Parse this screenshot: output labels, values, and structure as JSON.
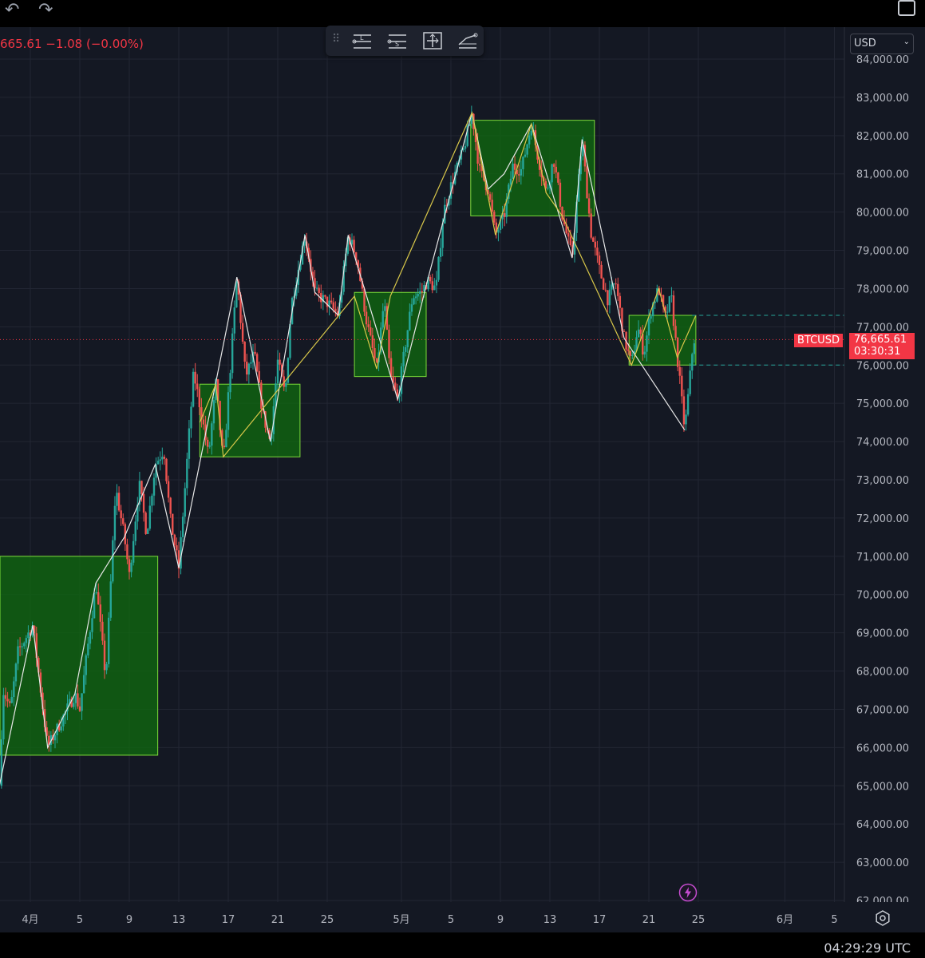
{
  "toolbar": {
    "price_change": "665.61 −1.08 (−0.00%)",
    "tools": [
      "long-position-tool",
      "short-position-tool",
      "measure-tool",
      "path-tool"
    ],
    "tool_labels": [
      "L",
      "S"
    ]
  },
  "currency": {
    "label": "USD"
  },
  "symbol_tag": {
    "symbol": "BTCUSD",
    "price": "76,665.61",
    "countdown": "03:30:31"
  },
  "clock": "04:29:29 UTC",
  "colors": {
    "background": "#141823",
    "grid": "#222633",
    "up": "#26a69a",
    "down": "#ef5350",
    "box_fill": "#0f6b0f",
    "box_stroke": "#7cdc3a",
    "zigzag_white": "#e8e8e8",
    "zigzag_yellow": "#d9c84a",
    "price_line": "#f23645",
    "range_line": "#26a69a"
  },
  "chart_data": {
    "type": "candlestick",
    "symbol": "BTCUSD",
    "ylim": [
      62000,
      84000
    ],
    "y_ticks": [
      84000,
      83000,
      82000,
      81000,
      80000,
      79000,
      78000,
      77000,
      76000,
      75000,
      74000,
      73000,
      72000,
      71000,
      70000,
      69000,
      68000,
      67000,
      66000,
      65000,
      64000,
      63000,
      62000
    ],
    "y_tick_labels": [
      "84,000.00",
      "83,000.00",
      "82,000.00",
      "81,000.00",
      "80,000.00",
      "79,000.00",
      "78,000.00",
      "77,000.00",
      "76,000.00",
      "75,000.00",
      "74,000.00",
      "73,000.00",
      "72,000.00",
      "71,000.00",
      "70,000.00",
      "69,000.00",
      "68,000.00",
      "67,000.00",
      "66,000.00",
      "65,000.00",
      "64,000.00",
      "63,000.00",
      "62,000.00"
    ],
    "x_start_day": 0,
    "x_end_day": 65,
    "x_ticks": [
      {
        "day": 0,
        "label": "4月"
      },
      {
        "day": 4,
        "label": "5"
      },
      {
        "day": 8,
        "label": "9"
      },
      {
        "day": 12,
        "label": "13"
      },
      {
        "day": 16,
        "label": "17"
      },
      {
        "day": 20,
        "label": "21"
      },
      {
        "day": 24,
        "label": "25"
      },
      {
        "day": 30,
        "label": "5月"
      },
      {
        "day": 34,
        "label": "5"
      },
      {
        "day": 38,
        "label": "9"
      },
      {
        "day": 42,
        "label": "13"
      },
      {
        "day": 46,
        "label": "17"
      },
      {
        "day": 50,
        "label": "21"
      },
      {
        "day": 54,
        "label": "25"
      },
      {
        "day": 61,
        "label": "6月"
      },
      {
        "day": 65,
        "label": "5"
      }
    ],
    "path": [
      [
        -2.5,
        65000
      ],
      [
        -2.2,
        67500
      ],
      [
        -1.6,
        67000
      ],
      [
        -1.0,
        68500
      ],
      [
        0.2,
        69200
      ],
      [
        1.4,
        66000
      ],
      [
        3.6,
        67400
      ],
      [
        4.0,
        67000
      ],
      [
        5.3,
        70300
      ],
      [
        6.1,
        67800
      ],
      [
        6.9,
        72800
      ],
      [
        7.6,
        71500
      ],
      [
        8.0,
        70500
      ],
      [
        8.8,
        72900
      ],
      [
        9.4,
        71600
      ],
      [
        10.1,
        73400
      ],
      [
        10.8,
        73800
      ],
      [
        11.3,
        72000
      ],
      [
        12.0,
        70700
      ],
      [
        12.6,
        73200
      ],
      [
        13.2,
        75800
      ],
      [
        13.9,
        74600
      ],
      [
        14.4,
        73600
      ],
      [
        15.0,
        75500
      ],
      [
        15.6,
        73400
      ],
      [
        16.7,
        78300
      ],
      [
        17.4,
        75700
      ],
      [
        18.1,
        76300
      ],
      [
        18.8,
        74700
      ],
      [
        19.4,
        74000
      ],
      [
        20.0,
        76100
      ],
      [
        20.6,
        75200
      ],
      [
        21.1,
        77600
      ],
      [
        22.2,
        79400
      ],
      [
        23.0,
        77900
      ],
      [
        24.1,
        77600
      ],
      [
        24.9,
        77300
      ],
      [
        25.7,
        79400
      ],
      [
        26.4,
        78800
      ],
      [
        27.2,
        77100
      ],
      [
        28.0,
        75900
      ],
      [
        28.6,
        77700
      ],
      [
        29.1,
        75700
      ],
      [
        29.7,
        75100
      ],
      [
        30.3,
        76500
      ],
      [
        30.9,
        77800
      ],
      [
        31.6,
        77900
      ],
      [
        32.1,
        78200
      ],
      [
        32.8,
        78000
      ],
      [
        33.4,
        80000
      ],
      [
        34.1,
        80800
      ],
      [
        35.0,
        81600
      ],
      [
        35.7,
        82600
      ],
      [
        36.3,
        81100
      ],
      [
        37.0,
        80600
      ],
      [
        37.6,
        79400
      ],
      [
        38.3,
        79900
      ],
      [
        39.0,
        81200
      ],
      [
        39.7,
        81100
      ],
      [
        40.5,
        82300
      ],
      [
        41.0,
        81500
      ],
      [
        41.7,
        80500
      ],
      [
        42.3,
        81400
      ],
      [
        43.0,
        79900
      ],
      [
        43.8,
        78800
      ],
      [
        44.6,
        81900
      ],
      [
        45.3,
        79500
      ],
      [
        46.0,
        78500
      ],
      [
        46.7,
        77700
      ],
      [
        47.3,
        78200
      ],
      [
        48.0,
        76700
      ],
      [
        48.6,
        76000
      ],
      [
        49.1,
        77000
      ],
      [
        49.6,
        76300
      ],
      [
        50.2,
        77500
      ],
      [
        50.8,
        78000
      ],
      [
        51.3,
        77200
      ],
      [
        51.8,
        77800
      ],
      [
        52.3,
        76200
      ],
      [
        52.9,
        74300
      ],
      [
        53.3,
        75600
      ],
      [
        53.6,
        76700
      ],
      [
        53.8,
        76600
      ]
    ],
    "boxes": [
      {
        "x0": -3,
        "x1": 10.3,
        "y0": 65800,
        "y1": 71000
      },
      {
        "x0": 13.7,
        "x1": 21.8,
        "y0": 73600,
        "y1": 75500
      },
      {
        "x0": 26.2,
        "x1": 32.0,
        "y0": 75700,
        "y1": 77900
      },
      {
        "x0": 35.6,
        "x1": 45.6,
        "y0": 79900,
        "y1": 82400
      },
      {
        "x0": 48.4,
        "x1": 53.8,
        "y0": 76000,
        "y1": 77300
      }
    ],
    "zigzag_white": [
      [
        -2.5,
        65000
      ],
      [
        0.2,
        69200
      ],
      [
        1.4,
        66000
      ],
      [
        3.6,
        67400
      ],
      [
        5.3,
        70300
      ],
      [
        7.6,
        71500
      ],
      [
        10.1,
        73400
      ],
      [
        12.0,
        70700
      ],
      [
        16.7,
        78300
      ],
      [
        19.4,
        74000
      ],
      [
        22.2,
        79400
      ],
      [
        23.0,
        77900
      ],
      [
        24.9,
        77300
      ],
      [
        25.7,
        79400
      ],
      [
        29.7,
        75100
      ],
      [
        32.1,
        78200
      ],
      [
        35.7,
        82600
      ],
      [
        37.0,
        80600
      ],
      [
        38.3,
        81000
      ],
      [
        40.5,
        82300
      ],
      [
        43.8,
        78800
      ],
      [
        44.6,
        81900
      ],
      [
        48.0,
        76700
      ],
      [
        52.9,
        74300
      ]
    ],
    "zigzag_yellow": [
      [
        13.7,
        74500
      ],
      [
        15.0,
        75500
      ],
      [
        15.6,
        73600
      ],
      [
        26.2,
        77800
      ],
      [
        28.0,
        75900
      ],
      [
        29.1,
        77800
      ],
      [
        35.7,
        82600
      ],
      [
        37.6,
        79400
      ],
      [
        40.5,
        82300
      ],
      [
        41.7,
        80500
      ],
      [
        43.0,
        79900
      ],
      [
        48.6,
        76000
      ],
      [
        50.8,
        78000
      ],
      [
        52.3,
        76200
      ],
      [
        53.8,
        77300
      ]
    ],
    "current_price": 76665.61,
    "range_lines": [
      77300,
      76000
    ]
  }
}
